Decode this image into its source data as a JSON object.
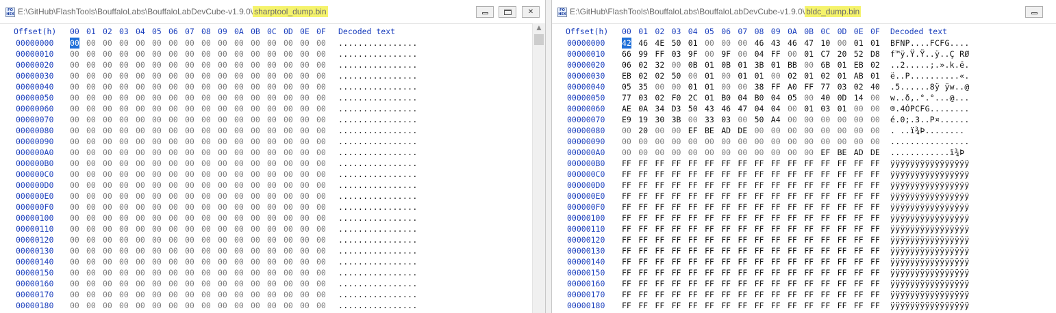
{
  "left": {
    "title_prefix": "E:\\GitHub\\FlashTools\\BouffaloLabs\\BouffaloLabDevCube-v1.9.0\\",
    "filename": "sharptool_dump.bin",
    "icon_label": "FO\nHEX",
    "header": {
      "offset": "Offset(h)",
      "columns": [
        "00",
        "01",
        "02",
        "03",
        "04",
        "05",
        "06",
        "07",
        "08",
        "09",
        "0A",
        "0B",
        "0C",
        "0D",
        "0E",
        "0F"
      ],
      "decoded": "Decoded text"
    },
    "rows": [
      {
        "offset": "00000000",
        "bytes": [
          "00",
          "00",
          "00",
          "00",
          "00",
          "00",
          "00",
          "00",
          "00",
          "00",
          "00",
          "00",
          "00",
          "00",
          "00",
          "00"
        ],
        "text": "................"
      },
      {
        "offset": "00000010",
        "bytes": [
          "00",
          "00",
          "00",
          "00",
          "00",
          "00",
          "00",
          "00",
          "00",
          "00",
          "00",
          "00",
          "00",
          "00",
          "00",
          "00"
        ],
        "text": "................"
      },
      {
        "offset": "00000020",
        "bytes": [
          "00",
          "00",
          "00",
          "00",
          "00",
          "00",
          "00",
          "00",
          "00",
          "00",
          "00",
          "00",
          "00",
          "00",
          "00",
          "00"
        ],
        "text": "................"
      },
      {
        "offset": "00000030",
        "bytes": [
          "00",
          "00",
          "00",
          "00",
          "00",
          "00",
          "00",
          "00",
          "00",
          "00",
          "00",
          "00",
          "00",
          "00",
          "00",
          "00"
        ],
        "text": "................"
      },
      {
        "offset": "00000040",
        "bytes": [
          "00",
          "00",
          "00",
          "00",
          "00",
          "00",
          "00",
          "00",
          "00",
          "00",
          "00",
          "00",
          "00",
          "00",
          "00",
          "00"
        ],
        "text": "................"
      },
      {
        "offset": "00000050",
        "bytes": [
          "00",
          "00",
          "00",
          "00",
          "00",
          "00",
          "00",
          "00",
          "00",
          "00",
          "00",
          "00",
          "00",
          "00",
          "00",
          "00"
        ],
        "text": "................"
      },
      {
        "offset": "00000060",
        "bytes": [
          "00",
          "00",
          "00",
          "00",
          "00",
          "00",
          "00",
          "00",
          "00",
          "00",
          "00",
          "00",
          "00",
          "00",
          "00",
          "00"
        ],
        "text": "................"
      },
      {
        "offset": "00000070",
        "bytes": [
          "00",
          "00",
          "00",
          "00",
          "00",
          "00",
          "00",
          "00",
          "00",
          "00",
          "00",
          "00",
          "00",
          "00",
          "00",
          "00"
        ],
        "text": "................"
      },
      {
        "offset": "00000080",
        "bytes": [
          "00",
          "00",
          "00",
          "00",
          "00",
          "00",
          "00",
          "00",
          "00",
          "00",
          "00",
          "00",
          "00",
          "00",
          "00",
          "00"
        ],
        "text": "................"
      },
      {
        "offset": "00000090",
        "bytes": [
          "00",
          "00",
          "00",
          "00",
          "00",
          "00",
          "00",
          "00",
          "00",
          "00",
          "00",
          "00",
          "00",
          "00",
          "00",
          "00"
        ],
        "text": "................"
      },
      {
        "offset": "000000A0",
        "bytes": [
          "00",
          "00",
          "00",
          "00",
          "00",
          "00",
          "00",
          "00",
          "00",
          "00",
          "00",
          "00",
          "00",
          "00",
          "00",
          "00"
        ],
        "text": "................"
      },
      {
        "offset": "000000B0",
        "bytes": [
          "00",
          "00",
          "00",
          "00",
          "00",
          "00",
          "00",
          "00",
          "00",
          "00",
          "00",
          "00",
          "00",
          "00",
          "00",
          "00"
        ],
        "text": "................"
      },
      {
        "offset": "000000C0",
        "bytes": [
          "00",
          "00",
          "00",
          "00",
          "00",
          "00",
          "00",
          "00",
          "00",
          "00",
          "00",
          "00",
          "00",
          "00",
          "00",
          "00"
        ],
        "text": "................"
      },
      {
        "offset": "000000D0",
        "bytes": [
          "00",
          "00",
          "00",
          "00",
          "00",
          "00",
          "00",
          "00",
          "00",
          "00",
          "00",
          "00",
          "00",
          "00",
          "00",
          "00"
        ],
        "text": "................"
      },
      {
        "offset": "000000E0",
        "bytes": [
          "00",
          "00",
          "00",
          "00",
          "00",
          "00",
          "00",
          "00",
          "00",
          "00",
          "00",
          "00",
          "00",
          "00",
          "00",
          "00"
        ],
        "text": "................"
      },
      {
        "offset": "000000F0",
        "bytes": [
          "00",
          "00",
          "00",
          "00",
          "00",
          "00",
          "00",
          "00",
          "00",
          "00",
          "00",
          "00",
          "00",
          "00",
          "00",
          "00"
        ],
        "text": "................"
      },
      {
        "offset": "00000100",
        "bytes": [
          "00",
          "00",
          "00",
          "00",
          "00",
          "00",
          "00",
          "00",
          "00",
          "00",
          "00",
          "00",
          "00",
          "00",
          "00",
          "00"
        ],
        "text": "................"
      },
      {
        "offset": "00000110",
        "bytes": [
          "00",
          "00",
          "00",
          "00",
          "00",
          "00",
          "00",
          "00",
          "00",
          "00",
          "00",
          "00",
          "00",
          "00",
          "00",
          "00"
        ],
        "text": "................"
      },
      {
        "offset": "00000120",
        "bytes": [
          "00",
          "00",
          "00",
          "00",
          "00",
          "00",
          "00",
          "00",
          "00",
          "00",
          "00",
          "00",
          "00",
          "00",
          "00",
          "00"
        ],
        "text": "................"
      },
      {
        "offset": "00000130",
        "bytes": [
          "00",
          "00",
          "00",
          "00",
          "00",
          "00",
          "00",
          "00",
          "00",
          "00",
          "00",
          "00",
          "00",
          "00",
          "00",
          "00"
        ],
        "text": "................"
      },
      {
        "offset": "00000140",
        "bytes": [
          "00",
          "00",
          "00",
          "00",
          "00",
          "00",
          "00",
          "00",
          "00",
          "00",
          "00",
          "00",
          "00",
          "00",
          "00",
          "00"
        ],
        "text": "................"
      },
      {
        "offset": "00000150",
        "bytes": [
          "00",
          "00",
          "00",
          "00",
          "00",
          "00",
          "00",
          "00",
          "00",
          "00",
          "00",
          "00",
          "00",
          "00",
          "00",
          "00"
        ],
        "text": "................"
      },
      {
        "offset": "00000160",
        "bytes": [
          "00",
          "00",
          "00",
          "00",
          "00",
          "00",
          "00",
          "00",
          "00",
          "00",
          "00",
          "00",
          "00",
          "00",
          "00",
          "00"
        ],
        "text": "................"
      },
      {
        "offset": "00000170",
        "bytes": [
          "00",
          "00",
          "00",
          "00",
          "00",
          "00",
          "00",
          "00",
          "00",
          "00",
          "00",
          "00",
          "00",
          "00",
          "00",
          "00"
        ],
        "text": "................"
      },
      {
        "offset": "00000180",
        "bytes": [
          "00",
          "00",
          "00",
          "00",
          "00",
          "00",
          "00",
          "00",
          "00",
          "00",
          "00",
          "00",
          "00",
          "00",
          "00",
          "00"
        ],
        "text": "................"
      }
    ]
  },
  "right": {
    "title_prefix": "E:\\GitHub\\FlashTools\\BouffaloLabs\\BouffaloLabDevCube-v1.9.0\\",
    "filename": "bldc_dump.bin",
    "icon_label": "FO\nHEX",
    "header": {
      "offset": "Offset(h)",
      "columns": [
        "00",
        "01",
        "02",
        "03",
        "04",
        "05",
        "06",
        "07",
        "08",
        "09",
        "0A",
        "0B",
        "0C",
        "0D",
        "0E",
        "0F"
      ],
      "decoded": "Decoded text"
    },
    "rows": [
      {
        "offset": "00000000",
        "bytes": [
          "42",
          "46",
          "4E",
          "50",
          "01",
          "00",
          "00",
          "00",
          "46",
          "43",
          "46",
          "47",
          "10",
          "00",
          "01",
          "01"
        ],
        "text": "BFNP....FCFG...."
      },
      {
        "offset": "00000010",
        "bytes": [
          "66",
          "99",
          "FF",
          "03",
          "9F",
          "00",
          "9F",
          "00",
          "04",
          "FF",
          "00",
          "01",
          "C7",
          "20",
          "52",
          "D8"
        ],
        "text": "f™ÿ.Ÿ.Ÿ..ÿ..Ç RØ"
      },
      {
        "offset": "00000020",
        "bytes": [
          "06",
          "02",
          "32",
          "00",
          "0B",
          "01",
          "0B",
          "01",
          "3B",
          "01",
          "BB",
          "00",
          "6B",
          "01",
          "EB",
          "02"
        ],
        "text": "..2.....;.».k.ë."
      },
      {
        "offset": "00000030",
        "bytes": [
          "EB",
          "02",
          "02",
          "50",
          "00",
          "01",
          "00",
          "01",
          "01",
          "00",
          "02",
          "01",
          "02",
          "01",
          "AB",
          "01"
        ],
        "text": "ë..P..........«."
      },
      {
        "offset": "00000040",
        "bytes": [
          "05",
          "35",
          "00",
          "00",
          "01",
          "01",
          "00",
          "00",
          "38",
          "FF",
          "A0",
          "FF",
          "77",
          "03",
          "02",
          "40"
        ],
        "text": ".5......8ÿ ÿw..@"
      },
      {
        "offset": "00000050",
        "bytes": [
          "77",
          "03",
          "02",
          "F0",
          "2C",
          "01",
          "B0",
          "04",
          "B0",
          "04",
          "05",
          "00",
          "40",
          "0D",
          "14",
          "00"
        ],
        "text": "w..ð,.°.°...@..."
      },
      {
        "offset": "00000060",
        "bytes": [
          "AE",
          "0A",
          "34",
          "D3",
          "50",
          "43",
          "46",
          "47",
          "04",
          "04",
          "00",
          "01",
          "03",
          "01",
          "00",
          "00"
        ],
        "text": "®.4ÓPCFG........"
      },
      {
        "offset": "00000070",
        "bytes": [
          "E9",
          "19",
          "30",
          "3B",
          "00",
          "33",
          "03",
          "00",
          "50",
          "A4",
          "00",
          "00",
          "00",
          "00",
          "00",
          "00"
        ],
        "text": "é.0;.3..P¤......"
      },
      {
        "offset": "00000080",
        "bytes": [
          "00",
          "20",
          "00",
          "00",
          "EF",
          "BE",
          "AD",
          "DE",
          "00",
          "00",
          "00",
          "00",
          "00",
          "00",
          "00",
          "00"
        ],
        "text": ". ..ï¾­Þ........"
      },
      {
        "offset": "00000090",
        "bytes": [
          "00",
          "00",
          "00",
          "00",
          "00",
          "00",
          "00",
          "00",
          "00",
          "00",
          "00",
          "00",
          "00",
          "00",
          "00",
          "00"
        ],
        "text": "................"
      },
      {
        "offset": "000000A0",
        "bytes": [
          "00",
          "00",
          "00",
          "00",
          "00",
          "00",
          "00",
          "00",
          "00",
          "00",
          "00",
          "00",
          "EF",
          "BE",
          "AD",
          "DE"
        ],
        "text": "............ï¾­Þ"
      },
      {
        "offset": "000000B0",
        "bytes": [
          "FF",
          "FF",
          "FF",
          "FF",
          "FF",
          "FF",
          "FF",
          "FF",
          "FF",
          "FF",
          "FF",
          "FF",
          "FF",
          "FF",
          "FF",
          "FF"
        ],
        "text": "ÿÿÿÿÿÿÿÿÿÿÿÿÿÿÿÿ"
      },
      {
        "offset": "000000C0",
        "bytes": [
          "FF",
          "FF",
          "FF",
          "FF",
          "FF",
          "FF",
          "FF",
          "FF",
          "FF",
          "FF",
          "FF",
          "FF",
          "FF",
          "FF",
          "FF",
          "FF"
        ],
        "text": "ÿÿÿÿÿÿÿÿÿÿÿÿÿÿÿÿ"
      },
      {
        "offset": "000000D0",
        "bytes": [
          "FF",
          "FF",
          "FF",
          "FF",
          "FF",
          "FF",
          "FF",
          "FF",
          "FF",
          "FF",
          "FF",
          "FF",
          "FF",
          "FF",
          "FF",
          "FF"
        ],
        "text": "ÿÿÿÿÿÿÿÿÿÿÿÿÿÿÿÿ"
      },
      {
        "offset": "000000E0",
        "bytes": [
          "FF",
          "FF",
          "FF",
          "FF",
          "FF",
          "FF",
          "FF",
          "FF",
          "FF",
          "FF",
          "FF",
          "FF",
          "FF",
          "FF",
          "FF",
          "FF"
        ],
        "text": "ÿÿÿÿÿÿÿÿÿÿÿÿÿÿÿÿ"
      },
      {
        "offset": "000000F0",
        "bytes": [
          "FF",
          "FF",
          "FF",
          "FF",
          "FF",
          "FF",
          "FF",
          "FF",
          "FF",
          "FF",
          "FF",
          "FF",
          "FF",
          "FF",
          "FF",
          "FF"
        ],
        "text": "ÿÿÿÿÿÿÿÿÿÿÿÿÿÿÿÿ"
      },
      {
        "offset": "00000100",
        "bytes": [
          "FF",
          "FF",
          "FF",
          "FF",
          "FF",
          "FF",
          "FF",
          "FF",
          "FF",
          "FF",
          "FF",
          "FF",
          "FF",
          "FF",
          "FF",
          "FF"
        ],
        "text": "ÿÿÿÿÿÿÿÿÿÿÿÿÿÿÿÿ"
      },
      {
        "offset": "00000110",
        "bytes": [
          "FF",
          "FF",
          "FF",
          "FF",
          "FF",
          "FF",
          "FF",
          "FF",
          "FF",
          "FF",
          "FF",
          "FF",
          "FF",
          "FF",
          "FF",
          "FF"
        ],
        "text": "ÿÿÿÿÿÿÿÿÿÿÿÿÿÿÿÿ"
      },
      {
        "offset": "00000120",
        "bytes": [
          "FF",
          "FF",
          "FF",
          "FF",
          "FF",
          "FF",
          "FF",
          "FF",
          "FF",
          "FF",
          "FF",
          "FF",
          "FF",
          "FF",
          "FF",
          "FF"
        ],
        "text": "ÿÿÿÿÿÿÿÿÿÿÿÿÿÿÿÿ"
      },
      {
        "offset": "00000130",
        "bytes": [
          "FF",
          "FF",
          "FF",
          "FF",
          "FF",
          "FF",
          "FF",
          "FF",
          "FF",
          "FF",
          "FF",
          "FF",
          "FF",
          "FF",
          "FF",
          "FF"
        ],
        "text": "ÿÿÿÿÿÿÿÿÿÿÿÿÿÿÿÿ"
      },
      {
        "offset": "00000140",
        "bytes": [
          "FF",
          "FF",
          "FF",
          "FF",
          "FF",
          "FF",
          "FF",
          "FF",
          "FF",
          "FF",
          "FF",
          "FF",
          "FF",
          "FF",
          "FF",
          "FF"
        ],
        "text": "ÿÿÿÿÿÿÿÿÿÿÿÿÿÿÿÿ"
      },
      {
        "offset": "00000150",
        "bytes": [
          "FF",
          "FF",
          "FF",
          "FF",
          "FF",
          "FF",
          "FF",
          "FF",
          "FF",
          "FF",
          "FF",
          "FF",
          "FF",
          "FF",
          "FF",
          "FF"
        ],
        "text": "ÿÿÿÿÿÿÿÿÿÿÿÿÿÿÿÿ"
      },
      {
        "offset": "00000160",
        "bytes": [
          "FF",
          "FF",
          "FF",
          "FF",
          "FF",
          "FF",
          "FF",
          "FF",
          "FF",
          "FF",
          "FF",
          "FF",
          "FF",
          "FF",
          "FF",
          "FF"
        ],
        "text": "ÿÿÿÿÿÿÿÿÿÿÿÿÿÿÿÿ"
      },
      {
        "offset": "00000170",
        "bytes": [
          "FF",
          "FF",
          "FF",
          "FF",
          "FF",
          "FF",
          "FF",
          "FF",
          "FF",
          "FF",
          "FF",
          "FF",
          "FF",
          "FF",
          "FF",
          "FF"
        ],
        "text": "ÿÿÿÿÿÿÿÿÿÿÿÿÿÿÿÿ"
      },
      {
        "offset": "00000180",
        "bytes": [
          "FF",
          "FF",
          "FF",
          "FF",
          "FF",
          "FF",
          "FF",
          "FF",
          "FF",
          "FF",
          "FF",
          "FF",
          "FF",
          "FF",
          "FF",
          "FF"
        ],
        "text": "ÿÿÿÿÿÿÿÿÿÿÿÿÿÿÿÿ"
      }
    ]
  },
  "colors": {
    "accent_blue": "#1b3fbd",
    "selection": "#1e6fd9",
    "filename_highlight": "#f5f36b"
  }
}
